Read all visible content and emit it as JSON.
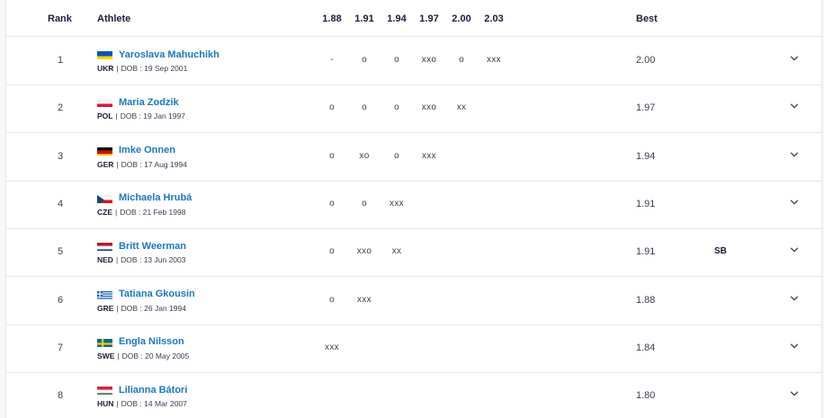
{
  "headers": {
    "rank": "Rank",
    "athlete": "Athlete",
    "heights": [
      "1.88",
      "1.91",
      "1.94",
      "1.97",
      "2.00",
      "2.03"
    ],
    "best": "Best"
  },
  "dob_label": "DOB : ",
  "separator": "|",
  "athletes": [
    {
      "rank": "1",
      "name": "Yaroslava Mahuchikh",
      "country": "UKR",
      "dob": "19 Sep 2001",
      "flag": "ukr-flag-icon",
      "results": [
        "-",
        "o",
        "o",
        "xxo",
        "o",
        "xxx"
      ],
      "best": "2.00",
      "note": ""
    },
    {
      "rank": "2",
      "name": "Maria Zodzik",
      "country": "POL",
      "dob": "19 Jan 1997",
      "flag": "pol-flag-icon",
      "results": [
        "o",
        "o",
        "o",
        "xxo",
        "xx",
        ""
      ],
      "best": "1.97",
      "note": ""
    },
    {
      "rank": "3",
      "name": "Imke Onnen",
      "country": "GER",
      "dob": "17 Aug 1994",
      "flag": "ger-flag-icon",
      "results": [
        "o",
        "xo",
        "o",
        "xxx",
        "",
        ""
      ],
      "best": "1.94",
      "note": ""
    },
    {
      "rank": "4",
      "name": "Michaela Hrubá",
      "country": "CZE",
      "dob": "21 Feb 1998",
      "flag": "cze-flag-icon",
      "results": [
        "o",
        "o",
        "xxx",
        "",
        "",
        ""
      ],
      "best": "1.91",
      "note": ""
    },
    {
      "rank": "5",
      "name": "Britt Weerman",
      "country": "NED",
      "dob": "13 Jun 2003",
      "flag": "ned-flag-icon",
      "results": [
        "o",
        "xxo",
        "xx",
        "",
        "",
        ""
      ],
      "best": "1.91",
      "note": "SB"
    },
    {
      "rank": "6",
      "name": "Tatiana Gkousin",
      "country": "GRE",
      "dob": "26 Jan 1994",
      "flag": "gre-flag-icon",
      "results": [
        "o",
        "xxx",
        "",
        "",
        "",
        ""
      ],
      "best": "1.88",
      "note": ""
    },
    {
      "rank": "7",
      "name": "Engla Nilsson",
      "country": "SWE",
      "dob": "20 May 2005",
      "flag": "swe-flag-icon",
      "results": [
        "xxx",
        "",
        "",
        "",
        "",
        ""
      ],
      "best": "1.84",
      "note": ""
    },
    {
      "rank": "8",
      "name": "Lilianna Bátori",
      "country": "HUN",
      "dob": "14 Mar 2007",
      "flag": "hun-flag-icon",
      "results": [
        "",
        "",
        "",
        "",
        "",
        ""
      ],
      "best": "1.80",
      "note": ""
    }
  ],
  "colors": {
    "accent_link": "#1c78c0",
    "text_dark": "#1c1d3a",
    "border": "#e3e6ec"
  }
}
